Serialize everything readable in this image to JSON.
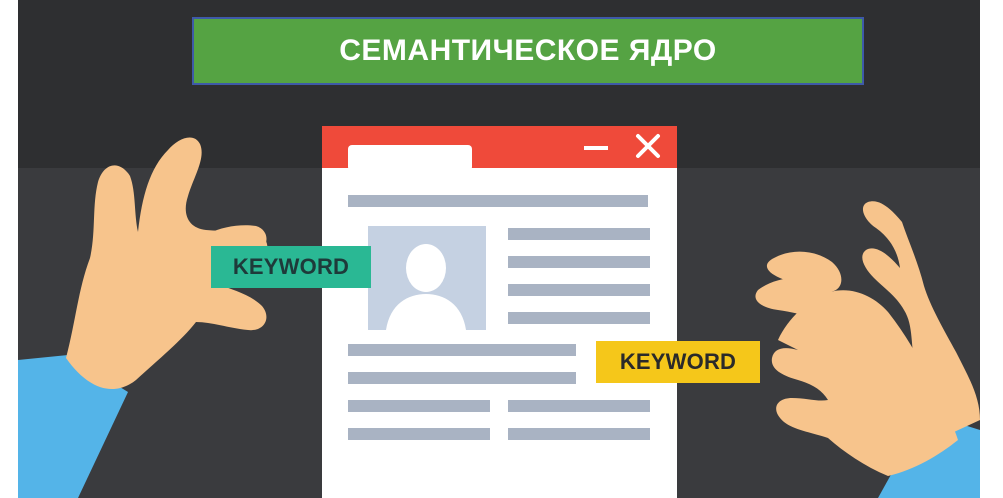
{
  "title": "СЕМАНТИЧЕСКОЕ ЯДРО",
  "window": {
    "minimize_glyph": "—",
    "close_glyph": "✕"
  },
  "tags": {
    "left": "KEYWORD",
    "right": "KEYWORD"
  },
  "colors": {
    "background_top": "#2e2f31",
    "background_bottom": "#3a3b3e",
    "title_banner": "#55a343",
    "title_border": "#3e5aa8",
    "window_header": "#ef4a3a",
    "window_body": "#ffffff",
    "content_line": "#a9b3c3",
    "avatar_bg": "#c5d1e2",
    "keyword_left": "#2ab894",
    "keyword_right": "#f5c71a",
    "skin": "#f7c48c",
    "sleeve": "#54b4e8"
  },
  "icons": [
    "minimize-icon",
    "close-icon",
    "avatar-icon"
  ]
}
